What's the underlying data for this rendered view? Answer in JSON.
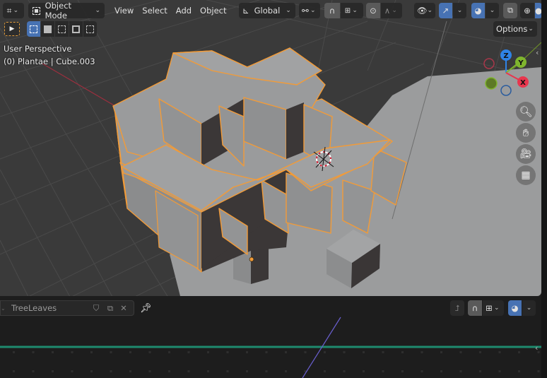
{
  "header": {
    "editor_type_icon": "object-data-icon",
    "mode": {
      "label": "Object Mode",
      "icon": "object-mode-icon"
    },
    "menus": [
      "View",
      "Select",
      "Add",
      "Object"
    ],
    "transform_orientation": {
      "label": "Global",
      "icon": "orientation-icon"
    },
    "pivot_icon": "pivot-point-icon",
    "snap_icon": "magnet-icon",
    "snap_target_icon": "snap-increment-icon",
    "proportional_icon": "proportional-edit-icon",
    "falloff_icon": "falloff-curve-icon",
    "visibility_icon": "eye-select-icon",
    "gizmo_icon": "gizmo-icon",
    "overlay_icon": "overlay-icon",
    "xray_icon": "xray-icon",
    "shading_wire_icon": "wireframe-sphere-icon",
    "options_label": "Options"
  },
  "toolbar": {
    "select_tool_icon": "cursor-select-icon",
    "select_modes": [
      "select-new-icon",
      "select-extend-icon",
      "select-subtract-icon",
      "select-invert-icon",
      "select-intersect-icon"
    ],
    "active_mode_index": 0
  },
  "viewport": {
    "view_name": "User Perspective",
    "object_info": "(0) Plantae | Cube.003",
    "gizmo_axes": {
      "x": "X",
      "y": "Y",
      "z": "Z"
    },
    "nav_buttons": [
      "zoom-icon",
      "pan-hand-icon",
      "camera-icon",
      "ortho-grid-icon"
    ],
    "colors": {
      "selection": "#f29b38",
      "axis_x": "#e8364e",
      "axis_y": "#7fb52e",
      "axis_z": "#2f83e6"
    }
  },
  "timeline": {
    "action_name": "TreeLeaves",
    "fake_user_icon": "shield-icon",
    "duplicate_icon": "copy-icon",
    "unlink_icon": "close-icon",
    "pin_icon": "pin-icon",
    "right_buttons": [
      "normalize-icon",
      "magnet-icon",
      "snap-icon",
      "overlay-icon"
    ]
  }
}
